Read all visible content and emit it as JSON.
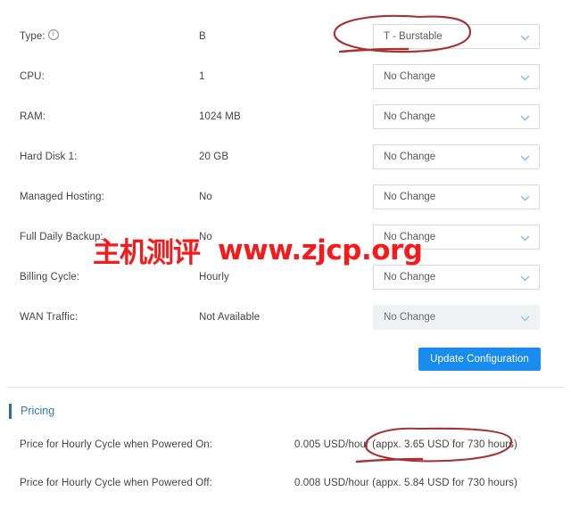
{
  "config": {
    "rows": [
      {
        "label": "Type:",
        "has_info_icon": true,
        "info_icon": "info-circle-icon",
        "value": "B",
        "select_value": "T - Burstable",
        "disabled": false
      },
      {
        "label": "CPU:",
        "has_info_icon": false,
        "value": "1",
        "select_value": "No Change",
        "disabled": false
      },
      {
        "label": "RAM:",
        "has_info_icon": false,
        "value": "1024 MB",
        "select_value": "No Change",
        "disabled": false
      },
      {
        "label": "Hard Disk 1:",
        "has_info_icon": false,
        "value": "20 GB",
        "select_value": "No Change",
        "disabled": false
      },
      {
        "label": "Managed Hosting:",
        "has_info_icon": false,
        "value": "No",
        "select_value": "No Change",
        "disabled": false
      },
      {
        "label": "Full Daily Backup:",
        "has_info_icon": false,
        "value": "No",
        "select_value": "No Change",
        "disabled": false
      },
      {
        "label": "Billing Cycle:",
        "has_info_icon": false,
        "value": "Hourly",
        "select_value": "No Change",
        "disabled": false
      },
      {
        "label": "WAN Traffic:",
        "has_info_icon": false,
        "value": "Not Available",
        "select_value": "No Change",
        "disabled": true
      }
    ],
    "update_button_label": "Update Configuration",
    "chevron_icon": "chevron-down-icon"
  },
  "pricing": {
    "title": "Pricing",
    "rows": [
      {
        "label": "Price for Hourly Cycle when Powered On:",
        "value": "0.005 USD/hour (appx. 3.65 USD for 730 hours)"
      },
      {
        "label": "Price for Hourly Cycle when Powered Off:",
        "value": "0.008 USD/hour (appx. 5.84 USD for 730 hours)"
      }
    ]
  },
  "watermark": {
    "chinese": "主机测评",
    "url": "www.zjcp.org"
  },
  "colors": {
    "accent_blue": "#1a8cf0",
    "pricing_blue": "#2f7ca8",
    "pricing_bar": "#2e6f96",
    "annotation_red": "#a83232",
    "watermark_red": "#f31b1b",
    "select_border": "#d9d9d9",
    "disabled_bg": "#f0f1f3"
  }
}
